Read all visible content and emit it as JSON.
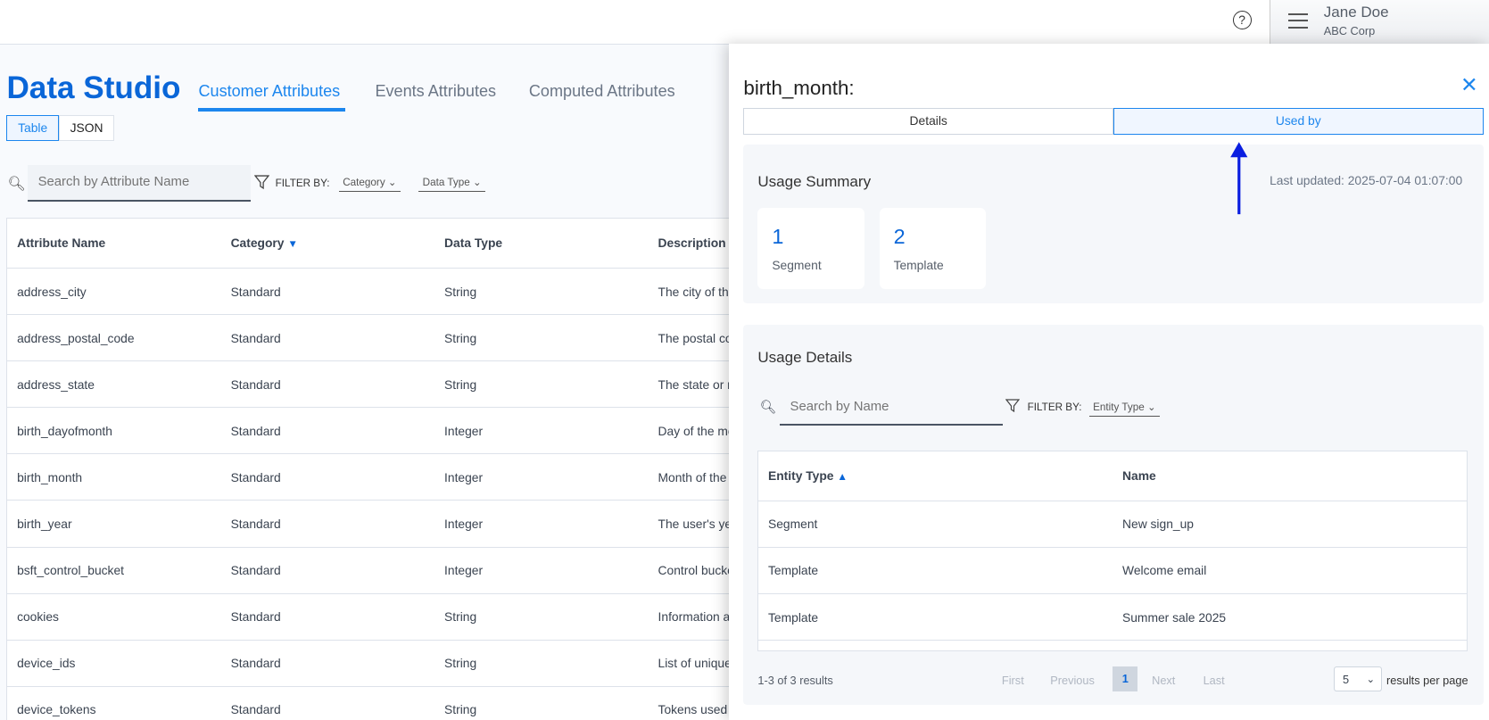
{
  "header": {
    "help_icon": "question-circle-icon",
    "menu_icon": "hamburger-icon",
    "user_name": "Jane Doe",
    "user_org": "ABC Corp"
  },
  "page": {
    "title": "Data Studio",
    "tabs": [
      {
        "label": "Customer Attributes",
        "active": true
      },
      {
        "label": "Events Attributes"
      },
      {
        "label": "Computed Attributes"
      }
    ],
    "view_toggle": [
      "Table",
      "JSON"
    ],
    "search_placeholder": "Search by Attribute Name",
    "filter_label": "FILTER BY:",
    "filters": [
      "Category",
      "Data Type"
    ]
  },
  "table": {
    "columns": [
      "Attribute Name",
      "Category",
      "Data Type",
      "Description"
    ],
    "sort_indicator": "▼",
    "rows": [
      [
        "address_city",
        "Standard",
        "String",
        "The city of the us"
      ],
      [
        "address_postal_code",
        "Standard",
        "String",
        "The postal code o"
      ],
      [
        "address_state",
        "Standard",
        "String",
        "The state or regio"
      ],
      [
        "birth_dayofmonth",
        "Standard",
        "Integer",
        "Day of the month"
      ],
      [
        "birth_month",
        "Standard",
        "Integer",
        "Month of the yea"
      ],
      [
        "birth_year",
        "Standard",
        "Integer",
        "The user's year o"
      ],
      [
        "bsft_control_bucket",
        "Standard",
        "Integer",
        "Control bucket nu"
      ],
      [
        "cookies",
        "Standard",
        "String",
        "Information abou"
      ],
      [
        "device_ids",
        "Standard",
        "String",
        "List of unique dev"
      ],
      [
        "device_tokens",
        "Standard",
        "String",
        "Tokens used for p"
      ]
    ]
  },
  "panel": {
    "title": "birth_month:",
    "close": "✕",
    "tabs": [
      {
        "label": "Details"
      },
      {
        "label": "Used by",
        "active": true
      }
    ],
    "summary": {
      "title": "Usage Summary",
      "last_updated": "Last updated: 2025-07-04 01:07:00",
      "stats": [
        {
          "value": "1",
          "label": "Segment"
        },
        {
          "value": "2",
          "label": "Template"
        }
      ]
    },
    "details": {
      "title": "Usage Details",
      "search_placeholder": "Search by Name",
      "filter_label": "FILTER BY:",
      "filter": "Entity Type",
      "columns": [
        "Entity Type",
        "Name"
      ],
      "sort_indicator": "▲",
      "rows": [
        [
          "Segment",
          "New sign_up"
        ],
        [
          "Template",
          "Welcome email"
        ],
        [
          "Template",
          "Summer sale 2025"
        ]
      ],
      "results": "1-3 of 3 results",
      "pager": {
        "first": "First",
        "previous": "Previous",
        "current": "1",
        "next": "Next",
        "last": "Last"
      },
      "per_page": "5",
      "per_page_label": "results per page"
    }
  },
  "annotation": {
    "arrow_color": "#0a1ee0"
  }
}
